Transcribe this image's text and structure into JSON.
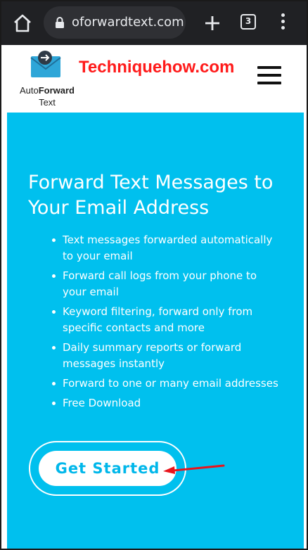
{
  "browser": {
    "url": "oforwardtext.com",
    "tab_count": "3",
    "colors": {
      "bar": "#202124",
      "url_box": "#2f3034",
      "text": "#e8eaed"
    },
    "icons": [
      "home-icon",
      "lock-icon",
      "new-tab-plus-icon",
      "tab-switcher-icon",
      "overflow-menu-icon"
    ]
  },
  "site": {
    "logo": {
      "line1_regular": "Auto",
      "line1_bold": "Forward",
      "line2": "Text",
      "icon": "envelope-arrow-icon"
    },
    "watermark": "Techniquehow.com",
    "menu_icon": "hamburger-menu-icon"
  },
  "hero": {
    "title": "Forward Text Messages to Your Email Address",
    "features": [
      "Text messages forwarded automatically to your email",
      "Forward call logs from your phone to your email",
      "Keyword filtering, forward only from specific contacts and more",
      "Daily summary reports or forward messages instantly",
      "Forward to one or many email addresses",
      "Free Download"
    ],
    "cta_label": "Get Started",
    "colors": {
      "background": "#00c0ee",
      "cta_text": "#00b7ea",
      "annotation_arrow": "#e8141c"
    }
  }
}
